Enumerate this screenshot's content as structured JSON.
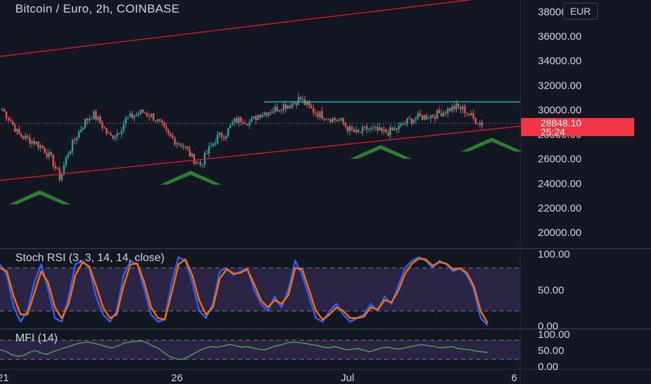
{
  "title": "Bitcoin / Euro, 2h, COINBASE",
  "currency": "EUR",
  "last_price": "28848.10",
  "countdown": "25:24",
  "indicators": {
    "stoch_label": "Stoch RSI (3, 3, 14, 14, close)",
    "mfi_label": "MFI (14)"
  },
  "colors": {
    "background": "#131722",
    "up": "#26a69a",
    "down": "#ef5350",
    "trendline": "#d1182a",
    "resistance": "#26c6da",
    "arrow": "#2e7d32",
    "stoch_k": "#2962ff",
    "stoch_d": "#ff6d00",
    "band": "#7e57c2",
    "mfi_line": "#4caf50",
    "price_tag": "#f23645"
  },
  "icons": [
    "support-arrow-icon"
  ],
  "chart_data": [
    {
      "type": "candlestick",
      "title": "Bitcoin / Euro, 2h, COINBASE",
      "y_ticks": [
        "38000.00",
        "36000.00",
        "34000.00",
        "32000.00",
        "30000.00",
        "28000.00",
        "26000.00",
        "24000.00",
        "22000.00",
        "20000.00"
      ],
      "y_tick_values": [
        38000,
        36000,
        34000,
        32000,
        30000,
        28000,
        26000,
        24000,
        22000,
        20000
      ],
      "x_ticks": [
        "21",
        "26",
        "Jul",
        "6"
      ],
      "ylim": [
        18700,
        38900
      ],
      "close_path": [
        30000,
        29100,
        27900,
        27600,
        27300,
        26800,
        25900,
        24400,
        26500,
        27800,
        29000,
        29600,
        28800,
        27700,
        28100,
        29200,
        29500,
        29800,
        29500,
        28900,
        27900,
        27400,
        27000,
        26000,
        25500,
        26700,
        27700,
        28000,
        29000,
        29200,
        28900,
        29600,
        29800,
        30000,
        30300,
        30400,
        30900,
        30200,
        29700,
        29400,
        29200,
        29000,
        28300,
        28000,
        28400,
        28300,
        28100,
        28200,
        28500,
        29000,
        29300,
        29400,
        29500,
        29700,
        30000,
        30200,
        29900,
        29200,
        28800
      ],
      "last_price": 28848.1,
      "resistance": 30600,
      "trendlines": [
        {
          "from": [
            0,
            34300
          ],
          "to": [
            700,
            39100
          ]
        },
        {
          "from": [
            0,
            24200
          ],
          "to": [
            760,
            28700
          ]
        }
      ],
      "support_markers": [
        24300,
        25900,
        28000,
        28600
      ]
    },
    {
      "type": "line",
      "title": "Stoch RSI (3, 3, 14, 14, close)",
      "ylim": [
        -4,
        106
      ],
      "y_ticks": [
        "100.00",
        "50.00",
        "0.00"
      ],
      "y_tick_values": [
        100,
        50,
        0
      ],
      "bands": [
        80,
        20
      ],
      "series": [
        {
          "values": [
            85,
            70,
            25,
            5,
            20,
            60,
            85,
            50,
            10,
            5,
            40,
            85,
            90,
            80,
            40,
            15,
            5,
            20,
            70,
            90,
            85,
            50,
            15,
            5,
            8,
            60,
            95,
            90,
            60,
            20,
            10,
            30,
            75,
            80,
            70,
            75,
            80,
            50,
            30,
            20,
            40,
            25,
            50,
            90,
            70,
            40,
            10,
            5,
            20,
            30,
            15,
            5,
            10,
            15,
            30,
            20,
            40,
            30,
            55,
            80,
            90,
            95,
            90,
            80,
            90,
            85,
            75,
            80,
            70,
            50,
            10,
            0
          ]
        },
        {
          "values": [
            80,
            75,
            40,
            15,
            15,
            45,
            75,
            60,
            25,
            10,
            30,
            70,
            88,
            82,
            55,
            25,
            10,
            15,
            55,
            85,
            86,
            60,
            25,
            10,
            8,
            45,
            85,
            92,
            70,
            35,
            15,
            25,
            65,
            78,
            72,
            73,
            78,
            58,
            35,
            25,
            35,
            30,
            42,
            80,
            78,
            50,
            20,
            8,
            15,
            25,
            20,
            10,
            10,
            12,
            25,
            22,
            35,
            32,
            48,
            72,
            86,
            93,
            92,
            83,
            88,
            86,
            78,
            79,
            73,
            55,
            20,
            3
          ]
        }
      ]
    },
    {
      "type": "line",
      "title": "MFI (14)",
      "ylim": [
        0,
        100
      ],
      "y_ticks": [
        "100.00",
        "50.00",
        "0.00"
      ],
      "y_tick_values": [
        100,
        50,
        0
      ],
      "bands": [
        80,
        20
      ],
      "series": [
        {
          "values": [
            50,
            45,
            35,
            30,
            32,
            42,
            48,
            40,
            36,
            44,
            50,
            56,
            62,
            68,
            72,
            74,
            70,
            66,
            60,
            56,
            62,
            70,
            74,
            76,
            78,
            72,
            62,
            54,
            40,
            28,
            22,
            20,
            28,
            38,
            48,
            56,
            60,
            58,
            62,
            66,
            64,
            58,
            60,
            56,
            52,
            50,
            56,
            62,
            66,
            72,
            74,
            72,
            70,
            66,
            64,
            58,
            56,
            60,
            55,
            50,
            52,
            54,
            48,
            44,
            50,
            56,
            58,
            54,
            52,
            56,
            60,
            64,
            66,
            62,
            60,
            56,
            58,
            60,
            54,
            52,
            50,
            46,
            44,
            42
          ]
        }
      ]
    }
  ]
}
